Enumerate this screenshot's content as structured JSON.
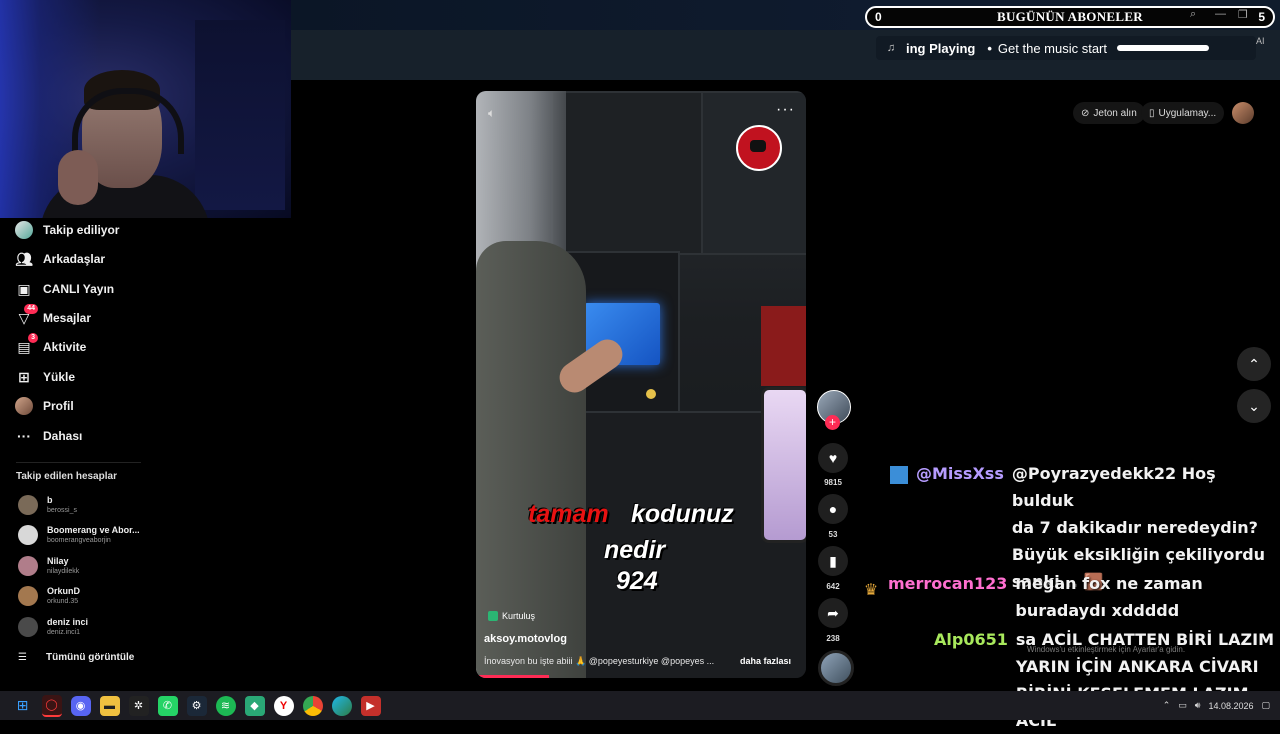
{
  "overlay": {
    "subscribers": {
      "left_count": "0",
      "title": "BUGÜNÜN ABONELER",
      "right_count": "5"
    },
    "music": {
      "now_playing": "ing Playing",
      "separator": "•",
      "message": "Get the music start",
      "progress": 1.0
    },
    "ai_label": "AI"
  },
  "topright": {
    "coins_label": "Jeton alın",
    "app_label": "Uygulamay..."
  },
  "sidebar": {
    "nav": [
      {
        "label": "Takip ediliyor",
        "icon": "following-avatar-icon"
      },
      {
        "label": "Arkadaşlar",
        "icon": "friends-icon"
      },
      {
        "label": "CANLI Yayın",
        "icon": "live-icon"
      },
      {
        "label": "Mesajlar",
        "icon": "messages-icon",
        "badge": "44"
      },
      {
        "label": "Aktivite",
        "icon": "activity-icon",
        "badge": "3"
      },
      {
        "label": "Yükle",
        "icon": "upload-icon"
      },
      {
        "label": "Profil",
        "icon": "profile-icon"
      },
      {
        "label": "Dahası",
        "icon": "more-icon"
      }
    ],
    "followed_title": "Takip edilen hesaplar",
    "accounts": [
      {
        "name": "b",
        "handle": "berossi_s",
        "color": "#7a6a58"
      },
      {
        "name": "Boomerang ve Abor...",
        "handle": "boomerangveaborjin",
        "color": "#d8d8d8"
      },
      {
        "name": "Nilay",
        "handle": "nilaydilekk",
        "color": "#b07d8a"
      },
      {
        "name": "OrkunD",
        "handle": "orkund.35",
        "color": "#a3784f"
      },
      {
        "name": "deniz inci",
        "handle": "deniz.inci1",
        "color": "#4a4a4a"
      }
    ],
    "show_all": "Tümünü görüntüle"
  },
  "video": {
    "caption": {
      "red": "tamam",
      "white_1": "kodunuz",
      "white_2": "nedir",
      "white_3": "924"
    },
    "location": "Kurtuluş",
    "username": "aksoy.motovlog",
    "description": "İnovasyon bu işte abiii 🙏 @popeyesturkiye @popeyes ...",
    "more": "daha fazlası",
    "progress": 0.22
  },
  "actions": {
    "likes": "9815",
    "comments": "53",
    "saves": "642",
    "shares": "238"
  },
  "chat": [
    {
      "user": "@MissXss",
      "color": "#b69cff",
      "icon_color": "#3b8ed8",
      "lines": [
        "@Poyrazyedekk22 Hoş bulduk",
        "da 7 dakikadır neredeydin?",
        "Büyük eksikliğin çekiliyordu",
        "sanki... 🟫"
      ]
    },
    {
      "user": "merrocan123",
      "color": "#ff6fd0",
      "icon_color": "#e6a93a",
      "lines": [
        "megan fox ne zaman",
        "buradaydı xddddd"
      ]
    },
    {
      "user": "Alp0651",
      "color": "#a8e85c",
      "icon_color": "",
      "lines": [
        "sa ACİL CHATTEN BİRİ LAZIM",
        "YARIN İÇİN ANKARA CİVARI",
        "BİRİNİ KESELEMEM LAZIM ACİL"
      ]
    }
  ],
  "activate_text": "Windows'u etkinleştirmek için Ayarlar'a gidin.",
  "taskbar": {
    "time": "",
    "date": "14.08.2026"
  }
}
